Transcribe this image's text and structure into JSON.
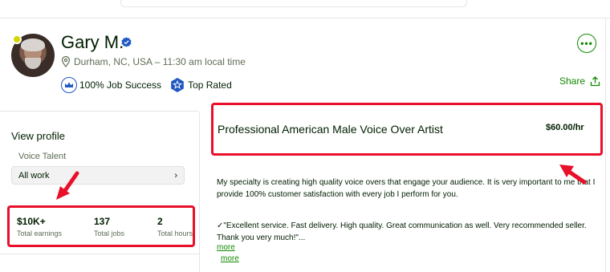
{
  "profile": {
    "name": "Gary M.",
    "location": "Durham, NC, USA – 11:30 am local time",
    "badges": [
      "100% Job Success",
      "Top Rated"
    ]
  },
  "actions": {
    "more_label": "•••",
    "share_label": "Share"
  },
  "sidebar": {
    "view_profile": "View profile",
    "specialized_profile": "Voice Talent",
    "all_work": "All work",
    "all_work_chevron": "›"
  },
  "stats": [
    {
      "value": "$10K+",
      "label": "Total earnings"
    },
    {
      "value": "137",
      "label": "Total jobs"
    },
    {
      "value": "2",
      "label": "Total hours"
    }
  ],
  "job": {
    "title": "Professional American Male Voice Over Artist",
    "rate": "$60.00/hr"
  },
  "description": {
    "text": "My specialty is creating high quality voice overs that engage your audience. It is very important to me that I provide 100% customer satisfaction with every job I perform for you.",
    "quote": "✓\"Excellent service. Fast delivery. High quality. Great communication as well. Very recommended seller. Thank you very much!\"...",
    "more_1": "more",
    "more_2": "more"
  },
  "colors": {
    "accent_green": "#108a00",
    "highlight_red": "#e8102a",
    "badge_blue": "#1f57c3",
    "online_dot": "#d6d600"
  }
}
